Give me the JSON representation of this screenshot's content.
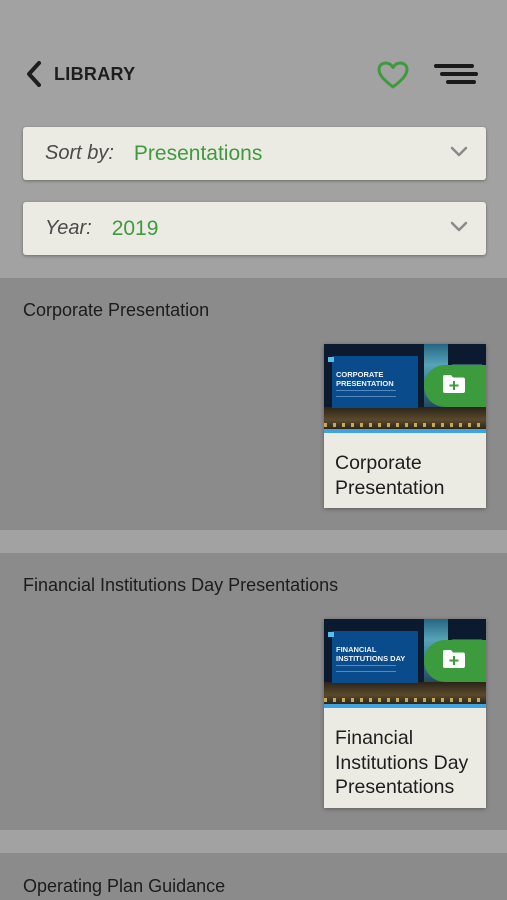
{
  "header": {
    "back_label": "LIBRARY"
  },
  "filters": {
    "sort_label": "Sort by:",
    "sort_value": "Presentations",
    "year_label": "Year:",
    "year_value": "2019"
  },
  "sections": [
    {
      "title": "Corporate Presentation",
      "cards": [
        {
          "thumb_title": "CORPORATE PRESENTATION",
          "title": "Corporate Presentation"
        }
      ]
    },
    {
      "title": "Financial Institutions Day Presentations",
      "cards": [
        {
          "thumb_title": "FINANCIAL INSTITUTIONS DAY",
          "title": "Financial Institutions Day Presentations"
        }
      ]
    },
    {
      "title": "Operating Plan Guidance",
      "cards": []
    }
  ],
  "colors": {
    "accent_green": "#3f9a3f",
    "page_background": "#a2a2a2",
    "section_background": "#8b8b8b",
    "card_background": "#ecebe3"
  },
  "icons": {
    "back": "chevron-left-icon",
    "favorite": "heart-outline-icon",
    "menu": "hamburger-menu-icon",
    "dropdown": "chevron-down-icon",
    "add_to_folder": "folder-plus-icon"
  }
}
